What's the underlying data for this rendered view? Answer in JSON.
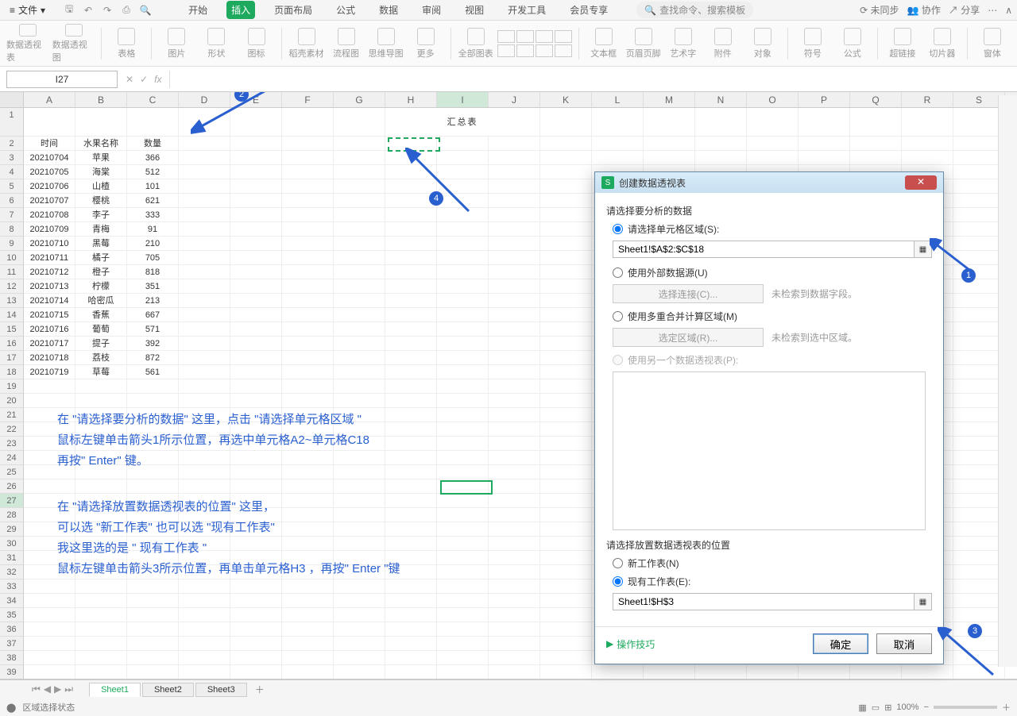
{
  "titlebar": {
    "file_menu": "文件",
    "tabs": [
      "开始",
      "插入",
      "页面布局",
      "公式",
      "数据",
      "审阅",
      "视图",
      "开发工具",
      "会员专享"
    ],
    "active_tab_index": 1,
    "search_placeholder": "查找命令、搜索模板",
    "right_items": [
      "未同步",
      "协作",
      "分享"
    ]
  },
  "ribbon": {
    "buttons": [
      "数据透视表",
      "数据透视图",
      "表格",
      "图片",
      "形状",
      "图标",
      "稻壳素材",
      "流程图",
      "思维导图",
      "更多",
      "全部图表",
      "",
      "",
      "",
      "",
      "文本框",
      "页眉页脚",
      "艺术字",
      "附件",
      "对象",
      "符号",
      "公式",
      "超链接",
      "切片器",
      "窗体"
    ]
  },
  "fxbar": {
    "name": "I27"
  },
  "columns": [
    "A",
    "B",
    "C",
    "D",
    "E",
    "F",
    "G",
    "H",
    "I",
    "J",
    "K",
    "L",
    "M",
    "N",
    "O",
    "P",
    "Q",
    "R",
    "S"
  ],
  "title_text": "汇总表",
  "headers": [
    "时间",
    "水果名称",
    "数量"
  ],
  "rows": [
    [
      "20210704",
      "苹果",
      "366"
    ],
    [
      "20210705",
      "海棠",
      "512"
    ],
    [
      "20210706",
      "山楂",
      "101"
    ],
    [
      "20210707",
      "樱桃",
      "621"
    ],
    [
      "20210708",
      "李子",
      "333"
    ],
    [
      "20210709",
      "青梅",
      "91"
    ],
    [
      "20210710",
      "黑莓",
      "210"
    ],
    [
      "20210711",
      "橘子",
      "705"
    ],
    [
      "20210712",
      "橙子",
      "818"
    ],
    [
      "20210713",
      "柠檬",
      "351"
    ],
    [
      "20210714",
      "哈密瓜",
      "213"
    ],
    [
      "20210715",
      "香蕉",
      "667"
    ],
    [
      "20210716",
      "葡萄",
      "571"
    ],
    [
      "20210717",
      "提子",
      "392"
    ],
    [
      "20210718",
      "荔枝",
      "872"
    ],
    [
      "20210719",
      "草莓",
      "561"
    ]
  ],
  "notes": {
    "block1": [
      "在 \"请选择要分析的数据\" 这里，点击 \"请选择单元格区域 \"",
      "鼠标左键单击箭头1所示位置，再选中单元格A2~单元格C18",
      "再按\" Enter\" 键。"
    ],
    "block2": [
      "在 \"请选择放置数据透视表的位置\" 这里，",
      "可以选 \"新工作表\" 也可以选 \"现有工作表\"",
      "我这里选的是 \" 现有工作表 \"",
      " 鼠标左键单击箭头3所示位置，再单击单元格H3 ，再按\" Enter \"键"
    ]
  },
  "dialog": {
    "title": "创建数据透视表",
    "section1": "请选择要分析的数据",
    "opt_cell": "请选择单元格区域(S):",
    "range_value": "Sheet1!$A$2:$C$18",
    "opt_ext": "使用外部数据源(U)",
    "btn_conn": "选择连接(C)...",
    "hint_conn": "未检索到数据字段。",
    "opt_multi": "使用多重合并计算区域(M)",
    "btn_area": "选定区域(R)...",
    "hint_area": "未检索到选中区域。",
    "opt_another": "使用另一个数据透视表(P):",
    "section2": "请选择放置数据透视表的位置",
    "opt_new": "新工作表(N)",
    "opt_exist": "现有工作表(E):",
    "loc_value": "Sheet1!$H$3",
    "tips": "操作技巧",
    "ok": "确定",
    "cancel": "取消"
  },
  "sheets": [
    "Sheet1",
    "Sheet2",
    "Sheet3"
  ],
  "statusbar": {
    "left": "区域选择状态",
    "zoom": "100%"
  },
  "markers": {
    "m1": "1",
    "m2": "2",
    "m3": "3",
    "m4": "4"
  }
}
